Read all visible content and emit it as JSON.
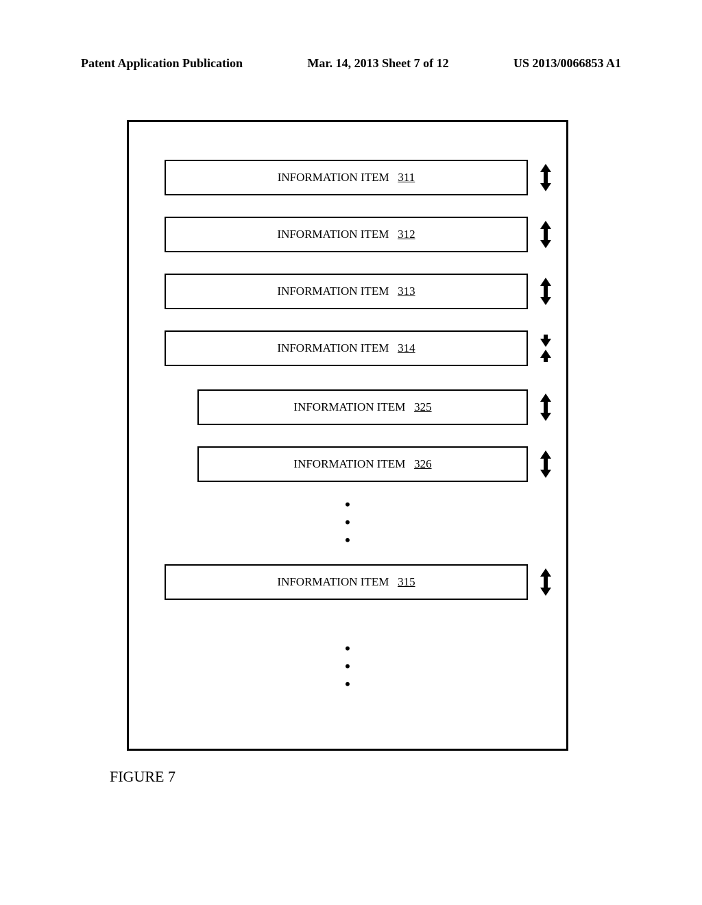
{
  "header": {
    "left": "Patent Application Publication",
    "center": "Mar. 14, 2013  Sheet 7 of 12",
    "right": "US 2013/0066853 A1"
  },
  "figure_caption": "FIGURE 7",
  "items": [
    {
      "label": "INFORMATION ITEM",
      "num": "311",
      "indent": 0,
      "arrow": "expand"
    },
    {
      "label": "INFORMATION ITEM",
      "num": "312",
      "indent": 0,
      "arrow": "expand"
    },
    {
      "label": "INFORMATION ITEM",
      "num": "313",
      "indent": 0,
      "arrow": "expand"
    },
    {
      "label": "INFORMATION ITEM",
      "num": "314",
      "indent": 0,
      "arrow": "collapse"
    },
    {
      "label": "INFORMATION ITEM",
      "num": "325",
      "indent": 1,
      "arrow": "expand"
    },
    {
      "label": "INFORMATION ITEM",
      "num": "326",
      "indent": 1,
      "arrow": "expand"
    },
    {
      "label": "INFORMATION ITEM",
      "num": "315",
      "indent": 0,
      "arrow": "expand"
    }
  ],
  "ellipsis": "•\n•\n•"
}
